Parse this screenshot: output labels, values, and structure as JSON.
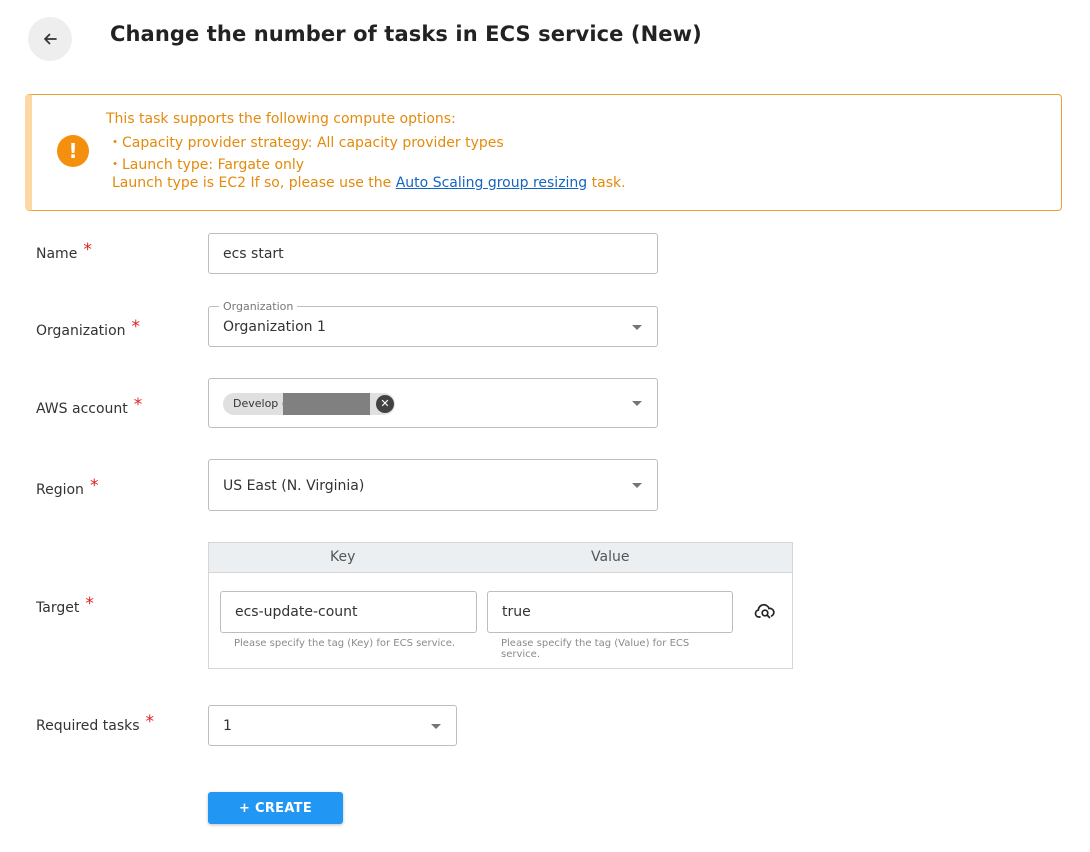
{
  "header": {
    "title": "Change the number of tasks in ECS service (New)",
    "back_icon": "arrow-left-icon"
  },
  "banner": {
    "icon": "exclamation-icon",
    "line1": "This task supports the following compute options:",
    "line2": "・Capacity provider strategy: All capacity provider types",
    "line3": "・Launch type: Fargate only",
    "line4_prefix": "Launch type is EC2 If so, please use the ",
    "line4_link": "Auto Scaling group resizing",
    "line4_suffix": " task.",
    "border_color": "#f0a030",
    "text_color": "#e48a0c",
    "icon_color": "#f5900f"
  },
  "form": {
    "required_mark": "*",
    "name": {
      "label": "Name",
      "value": "ecs start"
    },
    "organization": {
      "label": "Organization",
      "floating_label": "Organization",
      "value": "Organization 1"
    },
    "aws_account": {
      "label": "AWS account",
      "chip_text": "Develop ("
    },
    "region": {
      "label": "Region",
      "value": "US East (N. Virginia)"
    },
    "target": {
      "label": "Target",
      "key_header": "Key",
      "value_header": "Value",
      "key_value": "ecs-update-count",
      "value_value": "true",
      "key_helper": "Please specify the tag (Key) for ECS service.",
      "value_helper": "Please specify the tag (Value) for ECS service.",
      "action_icon": "cloud-search-icon"
    },
    "required_tasks": {
      "label": "Required tasks",
      "value": "1"
    }
  },
  "actions": {
    "create_label": "+ CREATE",
    "create_color": "#2196f3"
  }
}
